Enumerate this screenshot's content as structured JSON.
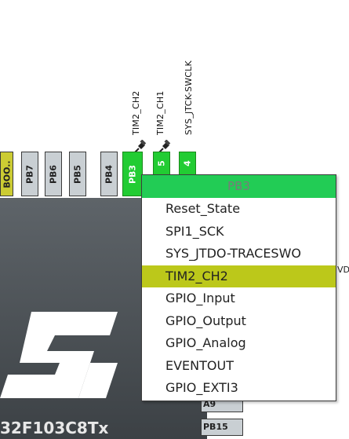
{
  "signals": {
    "tim2_ch2": "TIM2_CH2",
    "tim2_ch1": "TIM2_CH1",
    "sys_jtck": "SYS_JTCK-SWCLK"
  },
  "pins": {
    "boot": "BOO..",
    "pb7": "PB7",
    "pb6": "PB6",
    "pb5": "PB5",
    "pb4": "PB4",
    "pb3": "PB3",
    "p_a": "5",
    "p_b": "4"
  },
  "right_pins": {
    "partial": "A9",
    "pb15": "PB15"
  },
  "chip": {
    "name": "32F103C8Tx"
  },
  "menu": {
    "title": "PB3",
    "items": [
      {
        "label": "Reset_State"
      },
      {
        "label": "SPI1_SCK"
      },
      {
        "label": "SYS_JTDO-TRACESWO"
      },
      {
        "label": "TIM2_CH2",
        "selected": true
      },
      {
        "label": "GPIO_Input"
      },
      {
        "label": "GPIO_Output"
      },
      {
        "label": "GPIO_Analog"
      },
      {
        "label": "EVENTOUT"
      },
      {
        "label": "GPIO_EXTI3"
      }
    ]
  },
  "overflow_label": "VD",
  "colors": {
    "assigned_pin": "#22cc33",
    "menu_header": "#22cc55",
    "selected_item": "#bcc81a",
    "chip_body": "#4a5055"
  }
}
